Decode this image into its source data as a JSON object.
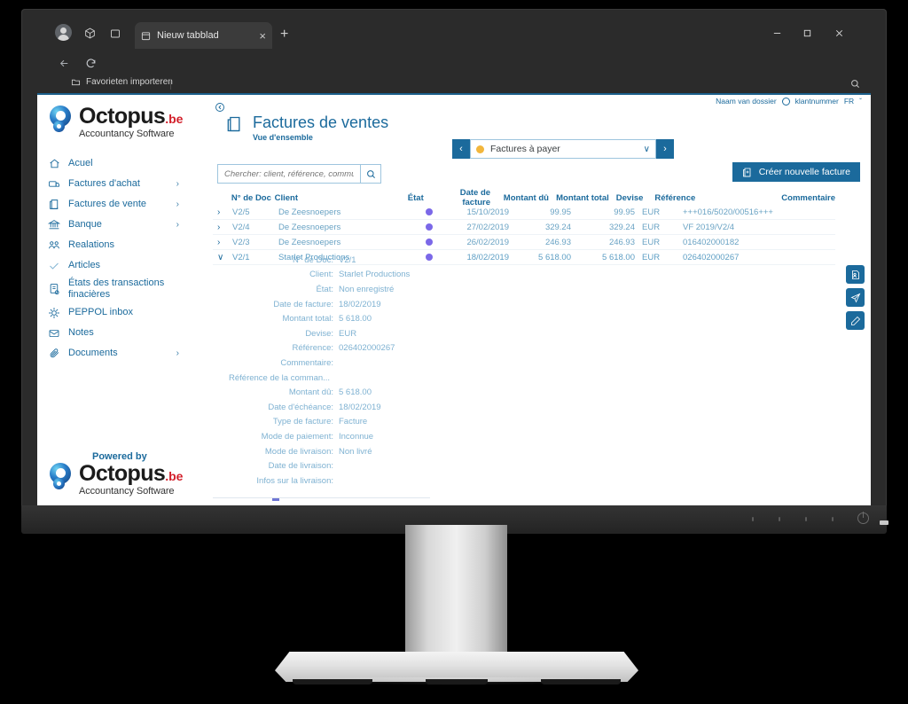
{
  "browser": {
    "tab_title": "Nieuw tabblad",
    "tab_close_label": "×",
    "new_tab_label": "+",
    "address_value": "",
    "window_minimize": "—",
    "window_maximize": "❐",
    "window_close": "✕",
    "bookmark_label": "Favorieten importeren"
  },
  "account": {
    "dossier": "Naam van dossier",
    "klantnummer": "klantnummer",
    "language": "FR",
    "language_chevron": "ˇ"
  },
  "brand": {
    "name": "Octopus",
    "tld": ".be",
    "tagline": "Accountancy Software",
    "powered_by": "Powered by"
  },
  "header": {
    "title": "Factures de ventes",
    "subtitle": "Vue d'ensemble",
    "collapse_icon": "collapse-panel-icon"
  },
  "sidebar": {
    "items": [
      {
        "label": "Acuel",
        "icon": "home-icon",
        "chevron": ""
      },
      {
        "label": "Factures d'achat",
        "icon": "purchase-invoice-icon",
        "chevron": "›"
      },
      {
        "label": "Factures de vente",
        "icon": "sales-invoice-icon",
        "chevron": "›"
      },
      {
        "label": "Banque",
        "icon": "bank-icon",
        "chevron": "›"
      },
      {
        "label": "Realations",
        "icon": "relations-icon",
        "chevron": ""
      },
      {
        "label": "Articles",
        "icon": "check-icon",
        "chevron": ""
      },
      {
        "label": "États des transactions finacières",
        "icon": "financial-statement-icon",
        "chevron": ""
      },
      {
        "label": "PEPPOL inbox",
        "icon": "peppol-icon",
        "chevron": ""
      },
      {
        "label": "Notes",
        "icon": "notes-icon",
        "chevron": ""
      },
      {
        "label": "Documents",
        "icon": "documents-icon",
        "chevron": "›"
      }
    ]
  },
  "toolbar": {
    "filter_prev": "‹",
    "filter_next": "›",
    "filter_value": "Factures à payer",
    "filter_chevron": "∨",
    "filter_dot_color": "#f2b63c",
    "search_placeholder": "Chercher: client, référence, commun",
    "search_value": "",
    "create_label": "Créer nouvelle facture"
  },
  "table": {
    "columns": {
      "doc": "N° de Doc",
      "client": "Client",
      "etat": "État",
      "date": "Date de facture",
      "due": "Montant dû",
      "total": "Montant total",
      "currency": "Devise",
      "reference": "Référence",
      "comment": "Commentaire"
    },
    "rows": [
      {
        "expand": "›",
        "doc": "V2/5",
        "client": "De Zeesnoepers",
        "etat_color": "#7b68e8",
        "date": "15/10/2019",
        "due": "99.95",
        "total": "99.95",
        "currency": "EUR",
        "reference": "+++016/5020/00516+++",
        "comment": ""
      },
      {
        "expand": "›",
        "doc": "V2/4",
        "client": "De Zeesnoepers",
        "etat_color": "#7b68e8",
        "date": "27/02/2019",
        "due": "329.24",
        "total": "329.24",
        "currency": "EUR",
        "reference": "VF 2019/V2/4",
        "comment": ""
      },
      {
        "expand": "›",
        "doc": "V2/3",
        "client": "De Zeesnoepers",
        "etat_color": "#7b68e8",
        "date": "26/02/2019",
        "due": "246.93",
        "total": "246.93",
        "currency": "EUR",
        "reference": "016402000182",
        "comment": ""
      },
      {
        "expand": "∨",
        "doc": "V2/1",
        "client": "Starlet Productions",
        "etat_color": "#7b68e8",
        "date": "18/02/2019",
        "due": "5 618.00",
        "total": "5 618.00",
        "currency": "EUR",
        "reference": "026402000267",
        "comment": ""
      }
    ]
  },
  "detail": {
    "fields": [
      {
        "label": "N° de Doc:",
        "value": "V2/1"
      },
      {
        "label": "Client:",
        "value": "Starlet Productions"
      },
      {
        "label": "État:",
        "value": "Non enregistré"
      },
      {
        "label": "Date de facture:",
        "value": "18/02/2019"
      },
      {
        "label": "Montant total:",
        "value": "5 618.00"
      },
      {
        "label": "Devise:",
        "value": "EUR"
      },
      {
        "label": "Référence:",
        "value": "026402000267"
      },
      {
        "label": "Commentaire:",
        "value": ""
      },
      {
        "label": "Référence de la comman...",
        "value": "",
        "wide": true
      },
      {
        "label": "Montant dû:",
        "value": "5 618.00"
      },
      {
        "label": "Date d'échéance:",
        "value": "18/02/2019"
      },
      {
        "label": "Type de facture:",
        "value": "Facture"
      },
      {
        "label": "Mode de paiement:",
        "value": "Inconnue"
      },
      {
        "label": "Mode de livraison:",
        "value": "Non livré"
      },
      {
        "label": "Date de livraison:",
        "value": ""
      },
      {
        "label": "Infos sur la livraison:",
        "value": ""
      }
    ]
  },
  "actions": [
    {
      "name": "view-document-button",
      "icon": "document-preview-icon"
    },
    {
      "name": "send-button",
      "icon": "send-paper-plane-icon"
    },
    {
      "name": "edit-button",
      "icon": "pencil-icon"
    }
  ],
  "colors": {
    "accent": "#1b6a9c",
    "status_dot": "#7b68e8",
    "filter_dot": "#f2b63c",
    "brand_red": "#d3202b"
  }
}
